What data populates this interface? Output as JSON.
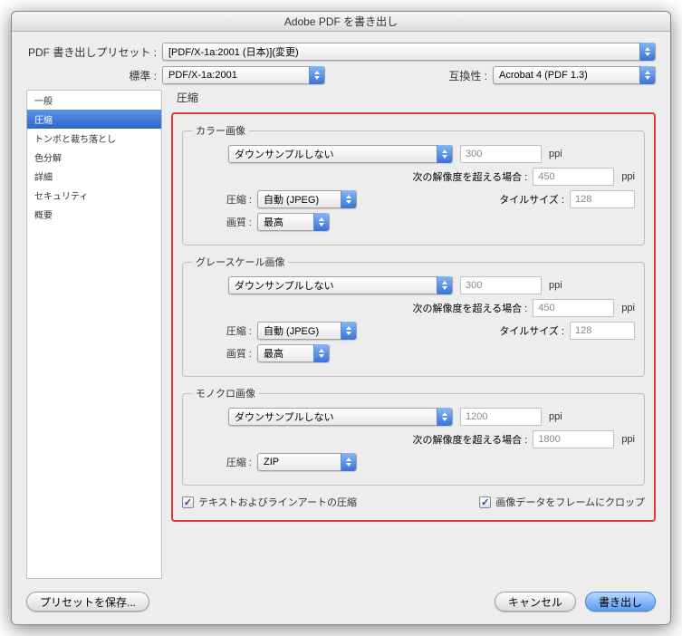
{
  "title": "Adobe PDF を書き出し",
  "preset": {
    "label": "PDF 書き出しプリセット :",
    "value": "[PDF/X-1a:2001 (日本)](変更)"
  },
  "standard": {
    "label": "標準 :",
    "value": "PDF/X-1a:2001"
  },
  "compat": {
    "label": "互換性 :",
    "value": "Acrobat 4 (PDF 1.3)"
  },
  "sidebar": {
    "items": [
      "一般",
      "圧縮",
      "トンボと裁ち落とし",
      "色分解",
      "詳細",
      "セキュリティ",
      "概要"
    ],
    "selected": 1
  },
  "section_title": "圧縮",
  "groups": {
    "color": {
      "legend": "カラー画像",
      "downsample": "ダウンサンプルしない",
      "ppi_label": "ppi",
      "ppi": "300",
      "threshold_label": "次の解像度を超える場合 :",
      "threshold": "450",
      "compress_label": "圧縮 :",
      "compress": "自動 (JPEG)",
      "tile_label": "タイルサイズ :",
      "tile": "128",
      "quality_label": "画質 :",
      "quality": "最高"
    },
    "gray": {
      "legend": "グレースケール画像",
      "downsample": "ダウンサンプルしない",
      "ppi_label": "ppi",
      "ppi": "300",
      "threshold_label": "次の解像度を超える場合 :",
      "threshold": "450",
      "compress_label": "圧縮 :",
      "compress": "自動 (JPEG)",
      "tile_label": "タイルサイズ :",
      "tile": "128",
      "quality_label": "画質 :",
      "quality": "最高"
    },
    "mono": {
      "legend": "モノクロ画像",
      "downsample": "ダウンサンプルしない",
      "ppi_label": "ppi",
      "ppi": "1200",
      "threshold_label": "次の解像度を超える場合 :",
      "threshold": "1800",
      "compress_label": "圧縮 :",
      "compress": "ZIP"
    }
  },
  "checkboxes": {
    "text_line": "テキストおよびラインアートの圧縮",
    "crop": "画像データをフレームにクロップ"
  },
  "buttons": {
    "save_preset": "プリセットを保存...",
    "cancel": "キャンセル",
    "export": "書き出し"
  }
}
